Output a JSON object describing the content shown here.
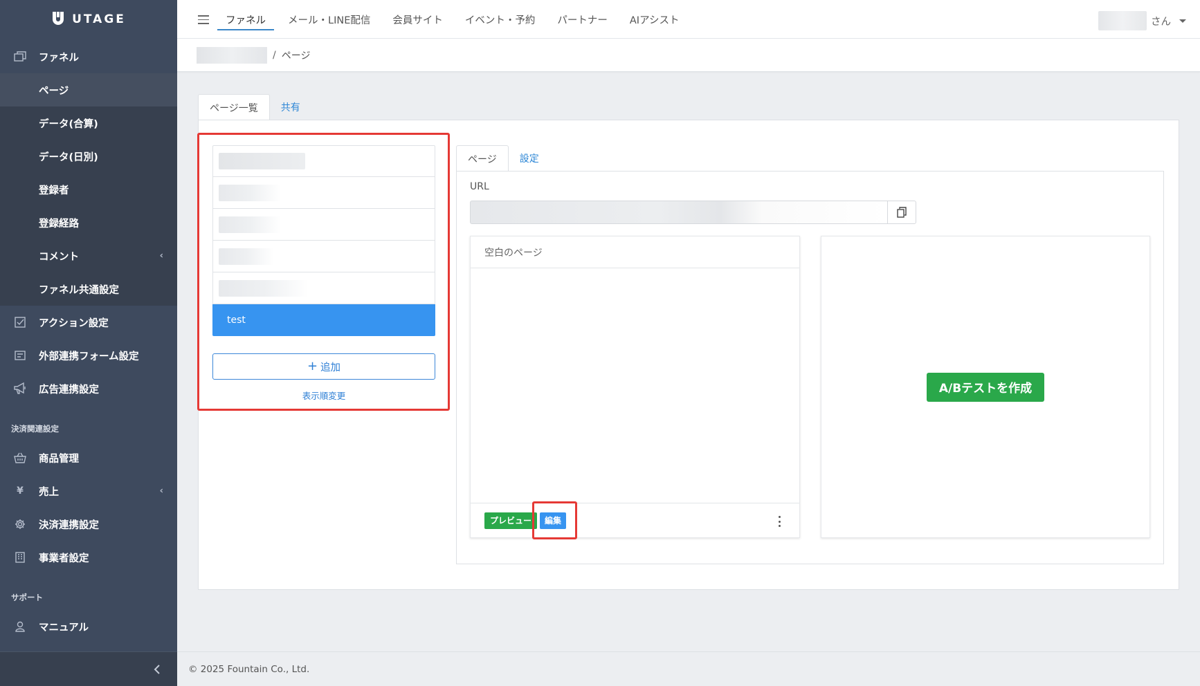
{
  "app": {
    "logo_text": "UTAGE"
  },
  "sidebar": {
    "funnel_label": "ファネル",
    "funnel_sub": [
      {
        "label": "ページ",
        "active": true
      },
      {
        "label": "データ(合算)"
      },
      {
        "label": "データ(日別)"
      },
      {
        "label": "登録者"
      },
      {
        "label": "登録経路"
      },
      {
        "label": "コメント",
        "has_chevron": true
      },
      {
        "label": "ファネル共通設定"
      }
    ],
    "items_top": [
      {
        "label": "アクション設定",
        "icon": "checkbox-icon"
      },
      {
        "label": "外部連携フォーム設定",
        "icon": "form-icon"
      },
      {
        "label": "広告連携設定",
        "icon": "megaphone-icon"
      }
    ],
    "section_payment": "決済関連設定",
    "items_payment": [
      {
        "label": "商品管理",
        "icon": "basket-icon"
      },
      {
        "label": "売上",
        "icon": "yen-icon",
        "has_chevron": true
      },
      {
        "label": "決済連携設定",
        "icon": "gear-icon"
      },
      {
        "label": "事業者設定",
        "icon": "building-icon"
      }
    ],
    "section_support": "サポート",
    "items_support": [
      {
        "label": "マニュアル",
        "icon": "person-icon"
      }
    ]
  },
  "topbar": {
    "tabs": [
      "ファネル",
      "メール・LINE配信",
      "会員サイト",
      "イベント・予約",
      "パートナー",
      "AIアシスト"
    ],
    "active_tab": 0,
    "user_suffix": "さん"
  },
  "breadcrumb": {
    "current": "ページ",
    "separator": "/"
  },
  "outer_tabs": [
    "ページ一覧",
    "共有"
  ],
  "page_list": {
    "blurred_item_count": 5,
    "selected_item": "test",
    "add_label": "追加",
    "reorder_label": "表示順変更"
  },
  "detail": {
    "tabs": [
      "ページ",
      "設定"
    ],
    "url_label": "URL",
    "page_title": "空白のページ",
    "preview_label": "プレビュー",
    "edit_label": "編集",
    "ab_test_label": "A/Bテストを作成"
  },
  "footer": {
    "copyright": "© 2025 Fountain Co., Ltd."
  },
  "colors": {
    "sidebar_bg": "#3e4a5e",
    "primary_blue": "#3794f0",
    "success_green": "#2aa84a",
    "highlight_red": "#e53935"
  }
}
